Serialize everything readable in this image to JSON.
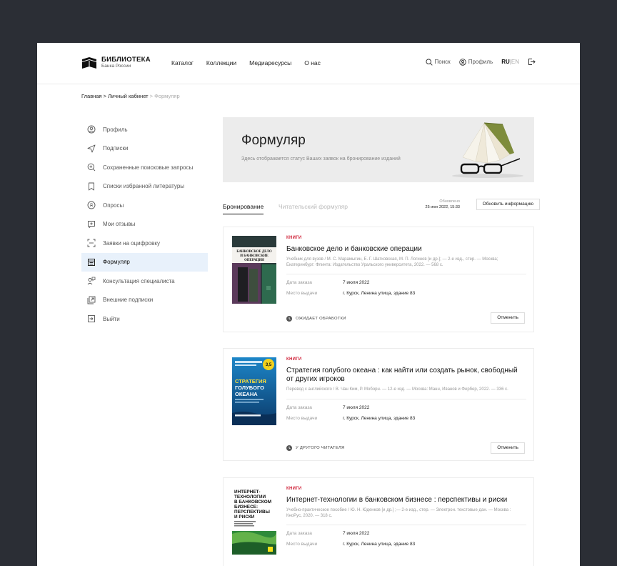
{
  "header": {
    "logo_title": "БИБЛИОТЕКА",
    "logo_sub": "Банка России",
    "nav": [
      "Каталог",
      "Коллекции",
      "Медиаресурсы",
      "О нас"
    ],
    "search": "Поиск",
    "profile": "Профиль",
    "lang_ru": "RU",
    "lang_sep": "|",
    "lang_en": "EN"
  },
  "breadcrumb": {
    "home": "Главная",
    "sep": ">",
    "cabinet": "Личный кабинет",
    "current": "Формуляр"
  },
  "sidebar": {
    "items": [
      {
        "label": "Профиль",
        "icon": "user-icon"
      },
      {
        "label": "Подписки",
        "icon": "send-icon"
      },
      {
        "label": "Сохраненные поисковые запросы",
        "icon": "search-plus-icon"
      },
      {
        "label": "Списки избранной литературы",
        "icon": "bookmark-icon"
      },
      {
        "label": "Опросы",
        "icon": "poll-icon"
      },
      {
        "label": "Мои отзывы",
        "icon": "review-icon"
      },
      {
        "label": "Заявки на оцифровку",
        "icon": "scan-icon"
      },
      {
        "label": "Формуляр",
        "icon": "form-icon"
      },
      {
        "label": "Консультация специалиста",
        "icon": "consult-icon"
      },
      {
        "label": "Внешние подписки",
        "icon": "external-icon"
      },
      {
        "label": "Выйти",
        "icon": "logout-icon"
      }
    ],
    "active_index": 7
  },
  "banner": {
    "title": "Формуляр",
    "subtitle": "Здесь отображается статус Ваших заявок на бронирование изданий"
  },
  "tabs": {
    "booking": "Бронирование",
    "reader_form": "Читательский формуляр",
    "updated_label": "Обновлено",
    "updated_date": "25 июн 2022, 15:33",
    "refresh_button": "Обновить информацию"
  },
  "cards": [
    {
      "type": "КНИГИ",
      "title": "Банковское дело и банковские операции",
      "desc": "Учебник для вузов / М. С. Марамыгин, Е. Г. Шатковская, М. П. Логинов [и др.]; — 2-е изд., стер. — Москва; Екатеринбург: Флинта: Издательство Уральского университета, 2022. — 568 с.",
      "order_label": "Дата заказа",
      "order_date": "7 июля 2022",
      "place_label": "Место выдачи",
      "place": "г. Курск, Ленина улица, здание 83",
      "status": "ОЖИДАЕТ ОБРАБОТКИ",
      "cancel": "Отменить",
      "cover_text": "БАНКОВСКОЕ ДЕЛО И БАНКОВСКИЕ ОПЕРАЦИИ"
    },
    {
      "type": "КНИГИ",
      "title": "Стратегия голубого океана : как найти или создать рынок, свободный от других игроков",
      "desc": "Перевод с английского / В. Чан Ким, Р. Моборн. — 12-е изд. — Москва: Манн, Иванов и Фербер, 2022. — 336 с.",
      "order_label": "Дата заказа",
      "order_date": "7 июля 2022",
      "place_label": "Место выдачи",
      "place": "г. Курск, Ленина улица, здание 83",
      "status": "У ДРУГОГО ЧИТАТЕЛЯ",
      "cancel": "Отменить",
      "cover_text": "СТРАТЕГИЯ ГОЛУБОГО ОКЕАНА"
    },
    {
      "type": "КНИГИ",
      "title": "Интернет-технологии в банковском бизнесе : перспективы и риски",
      "desc": "Учебно-практическое пособие / Ю. Н. Юденков [и др.] ;— 2-е изд., стер. — Электрон. текстовые дан. — Москва : КноРус, 2020. — 318 с.",
      "order_label": "Дата заказа",
      "order_date": "7 июля 2022",
      "place_label": "Место выдачи",
      "place": "г. Курск, Ленина улица, здание 83",
      "cover_text": "ИНТЕРНЕТ-ТЕХНОЛОГИИ В БАНКОВСКОМ БИЗНЕСЕ: ПЕРСПЕКТИВЫ И РИСКИ"
    }
  ]
}
